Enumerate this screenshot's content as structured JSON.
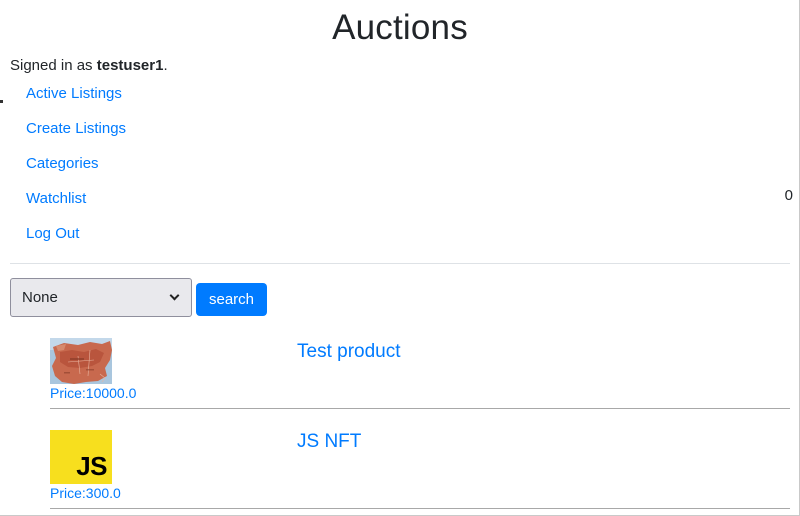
{
  "header": {
    "title": "Auctions",
    "signed_in_prefix": "Signed in as",
    "username": "testuser1",
    "signed_in_suffix": "."
  },
  "nav": {
    "items": [
      {
        "label": "Active Listings"
      },
      {
        "label": "Create Listings"
      },
      {
        "label": "Categories"
      },
      {
        "label": "Watchlist"
      },
      {
        "label": "Log Out"
      }
    ],
    "watchlist_count": "0"
  },
  "filter": {
    "selected_category": "None",
    "search_label": "search"
  },
  "listings": [
    {
      "title": "Test product",
      "price": "Price:10000.0",
      "image": "map-image"
    },
    {
      "title": "JS NFT",
      "price": "Price:300.0",
      "image": "js-logo",
      "logo_text": "JS"
    }
  ],
  "colors": {
    "link": "#007bff",
    "button_bg": "#007bff",
    "js_yellow": "#f7df1e"
  }
}
